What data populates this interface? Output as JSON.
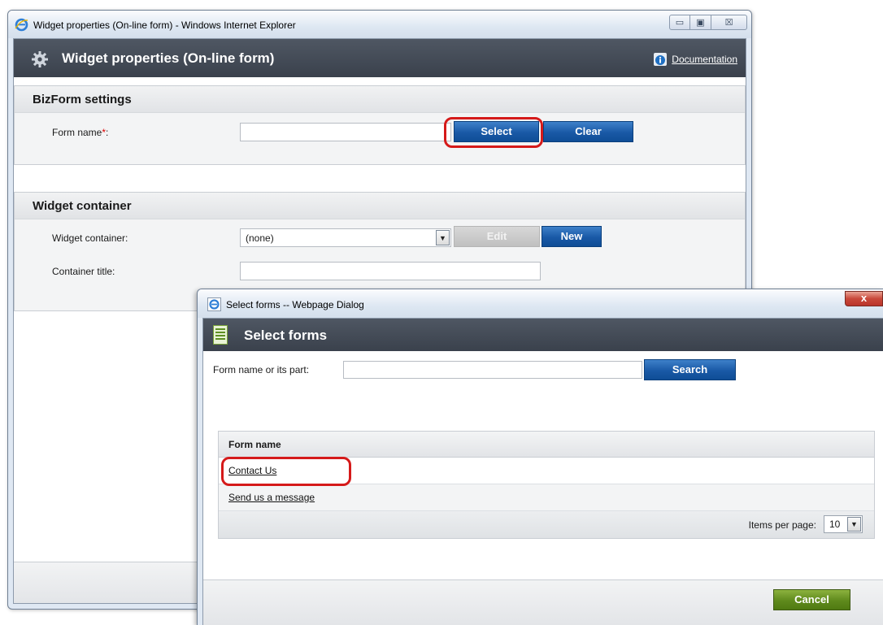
{
  "main_window": {
    "title": "Widget properties (On-line form) - Windows Internet Explorer",
    "controls": {
      "minimize": "▭",
      "maximize": "▣",
      "close": "☒"
    },
    "header": {
      "title": "Widget properties (On-line form)",
      "documentation_link": "Documentation"
    },
    "bizform_section": {
      "title": "BizForm settings",
      "form_name_label": "Form name",
      "form_name_required_mark": "*",
      "form_name_colon": ":",
      "form_name_value": "",
      "select_button": "Select",
      "clear_button": "Clear"
    },
    "widget_container_section": {
      "title": "Widget container",
      "container_label": "Widget container:",
      "container_value": "(none)",
      "edit_button": "Edit",
      "new_button": "New",
      "container_title_label": "Container title:",
      "container_title_value": ""
    }
  },
  "dialog": {
    "title": "Select forms -- Webpage Dialog",
    "close_label": "x",
    "header_title": "Select forms",
    "filter_label": "Form name or its part:",
    "filter_value": "",
    "search_button": "Search",
    "grid": {
      "column_header": "Form name",
      "rows": [
        "Contact Us",
        "Send us a message"
      ],
      "items_per_page_label": "Items per page:",
      "items_per_page_value": "10"
    },
    "cancel_button": "Cancel"
  },
  "colors": {
    "header_dark": "#3a414c",
    "button_blue": "#1959a6",
    "button_green": "#5f8a1c",
    "highlight_red": "#d51a1a"
  }
}
